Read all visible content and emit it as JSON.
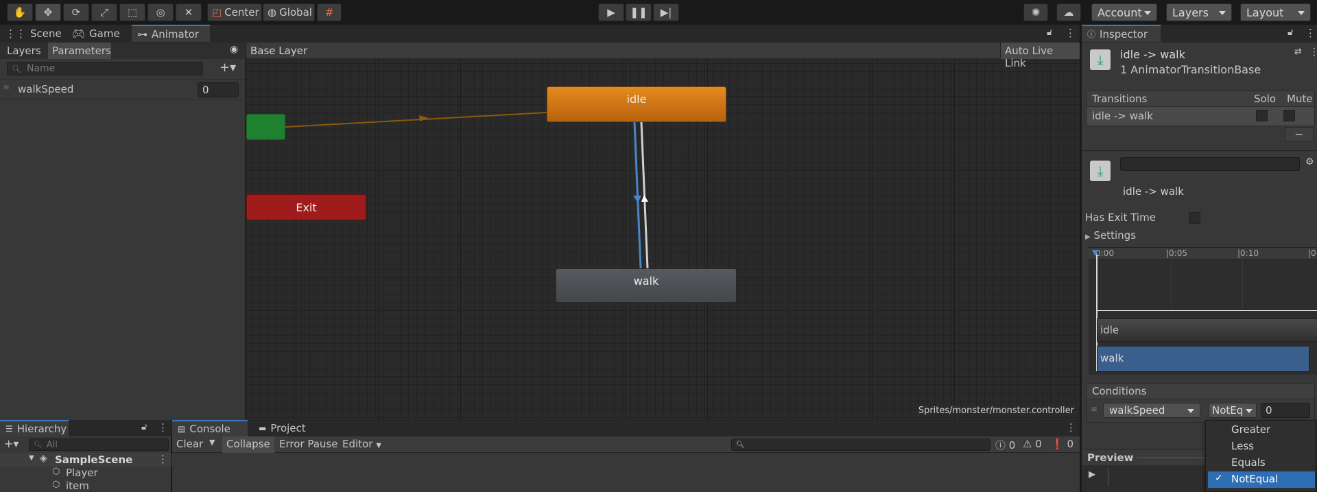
{
  "toolbar": {
    "center_label": "Center",
    "global_label": "Global",
    "account_label": "Account",
    "layers_label": "Layers",
    "layout_label": "Layout"
  },
  "tabs": {
    "scene": "Scene",
    "game": "Game",
    "animator": "Animator",
    "inspector": "Inspector"
  },
  "animator": {
    "layers_tab": "Layers",
    "parameters_tab": "Parameters",
    "search_placeholder": "Name",
    "parameter_name": "walkSpeed",
    "parameter_value": "0",
    "breadcrumb": "Base Layer",
    "auto_live_link": "Auto Live Link",
    "controller_path": "Sprites/monster/monster.controller",
    "states": {
      "idle": "idle",
      "walk": "walk",
      "exit": "Exit"
    }
  },
  "inspector": {
    "title": "idle -> walk",
    "subtitle": "1 AnimatorTransitionBase",
    "transitions_header": "Transitions",
    "solo_label": "Solo",
    "mute_label": "Mute",
    "transition_row": "idle -> walk",
    "minus_label": "−",
    "transition_name": "idle -> walk",
    "has_exit_time": "Has Exit Time",
    "settings": "Settings",
    "timeline_ticks": [
      "0:00",
      "|0:05",
      "|0:10",
      "|0"
    ],
    "track_idle": "idle",
    "track_walk": "walk",
    "conditions_header": "Conditions",
    "condition_param": "walkSpeed",
    "condition_op": "NotEq",
    "condition_value": "0",
    "preview": "Preview"
  },
  "dropdown_menu": {
    "options": [
      "Greater",
      "Less",
      "Equals",
      "NotEqual"
    ],
    "selected": "NotEqual"
  },
  "hierarchy": {
    "title": "Hierarchy",
    "search_placeholder": "All",
    "scene_name": "SampleScene",
    "items": [
      "Player",
      "item"
    ]
  },
  "console": {
    "console_tab": "Console",
    "project_tab": "Project",
    "clear": "Clear",
    "collapse": "Collapse",
    "error_pause": "Error Pause",
    "editor": "Editor",
    "info_count": "0",
    "warn_count": "0",
    "error_count": "0"
  },
  "colors": {
    "idle_state": "#c96e12",
    "walk_state": "#4d4f53",
    "exit_state": "#a01b1b",
    "entry_state": "#1f8030",
    "accent_blue": "#3a79bb",
    "selected_track": "#3b5f8c"
  }
}
